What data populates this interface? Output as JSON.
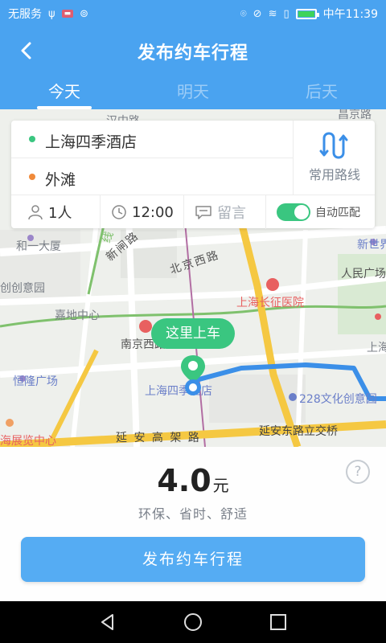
{
  "status_bar": {
    "carrier": "无服务",
    "time": "中午11:39",
    "battery_level": 0.9,
    "icons": [
      "usb-icon",
      "notification-icon",
      "wifi-icon",
      "location-icon",
      "mute-icon",
      "signal-icon",
      "sim-icon",
      "battery-icon"
    ]
  },
  "header": {
    "title": "发布约车行程",
    "back_icon": "chevron-left-icon",
    "tabs": [
      {
        "label": "今天",
        "active": true
      },
      {
        "label": "明天",
        "active": false
      },
      {
        "label": "后天",
        "active": false
      }
    ]
  },
  "route": {
    "origin": "上海四季酒店",
    "destination": "外滩",
    "common_route_label": "常用路线",
    "common_route_icon": "route-icon"
  },
  "options": {
    "passengers": "1人",
    "time": "12:00",
    "message_placeholder": "留言",
    "auto_match_label": "自动匹配",
    "auto_match_on": true
  },
  "map": {
    "pickup_bubble": "这里上车",
    "labels": {
      "hanzhong_road": "汉中路",
      "road_top_right": "昌京路",
      "heyi_mansion": "和一大厦",
      "xinzha_road": "新闸路",
      "beijing_west_road": "北京西路",
      "xinshijie": "新世界",
      "renmin_square": "人民广场",
      "chuangyi_garden": "创创意园",
      "jiadi_center": "嘉地中心",
      "changzheng_hospital": "上海长征医院",
      "nanjing_west_road": "南京西路",
      "shanghai_right": "上海",
      "hilong_plaza": "恒隆广场",
      "four_seasons_map": "上海四季酒店",
      "culture_park": "228文化创意园",
      "yanan_interchange": "延安东路立交桥",
      "exhibition_center": "海展览中心",
      "yanan_elevated": "延 安 高 架 路",
      "line_2": "线"
    },
    "route_color": "#3b8fe8"
  },
  "fare": {
    "amount": "4.0",
    "unit": "元",
    "tagline": "环保、省时、舒适",
    "help_symbol": "?"
  },
  "actions": {
    "publish_label": "发布约车行程"
  },
  "colors": {
    "primary": "#4aa3f0",
    "button": "#55acf3",
    "green": "#3ac680",
    "orange": "#f08a3a"
  }
}
